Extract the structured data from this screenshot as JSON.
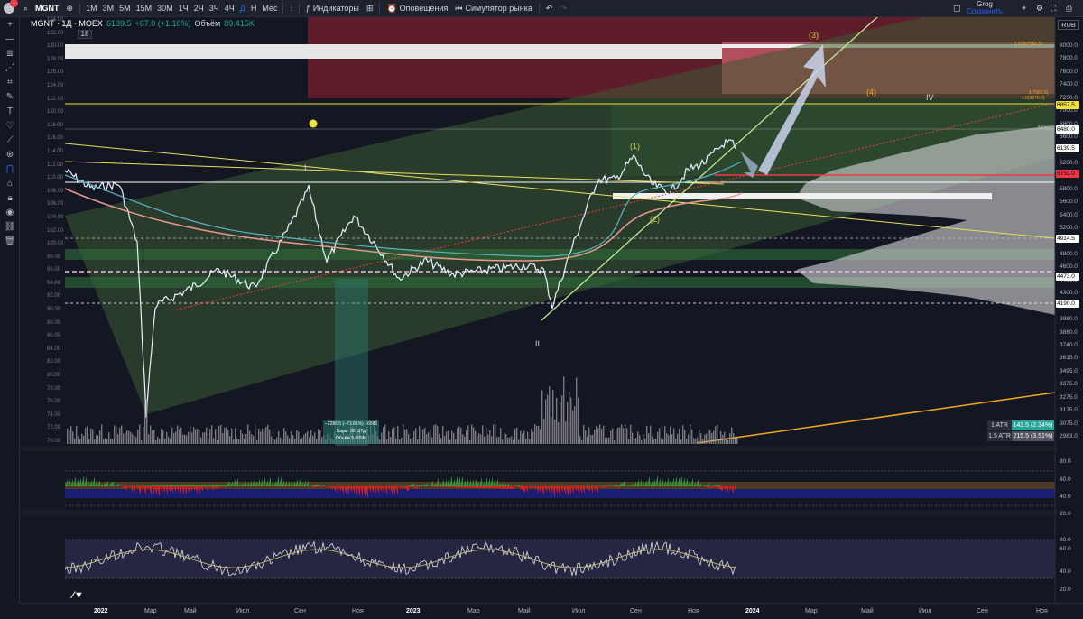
{
  "topbar": {
    "notif_count": "1",
    "symbol": "MGNT",
    "timeframes": [
      {
        "label": "1М",
        "active": false
      },
      {
        "label": "3М",
        "active": false
      },
      {
        "label": "5М",
        "active": false
      },
      {
        "label": "15М",
        "active": false
      },
      {
        "label": "30М",
        "active": false
      },
      {
        "label": "1Ч",
        "active": false
      },
      {
        "label": "2Ч",
        "active": false
      },
      {
        "label": "3Ч",
        "active": false
      },
      {
        "label": "4Ч",
        "active": false
      },
      {
        "label": "Д",
        "active": true
      },
      {
        "label": "Н",
        "active": false
      },
      {
        "label": "Мес",
        "active": false
      }
    ],
    "indicators_label": "Индикаторы",
    "alerts_label": "Оповещения",
    "replay_label": "Симулятор рынка",
    "user_name": "Grog",
    "save_label": "Сохранить"
  },
  "legend": {
    "title": "MGNT · 1Д · MOEX",
    "last": "6139.5",
    "change": "+67.0 (+1.10%)",
    "volume_label": "Объём",
    "volume": "89.415K",
    "series_count": "18"
  },
  "currency": "RUB",
  "right_axis": [
    "8000.0",
    "7800.0",
    "7600.0",
    "7400.0",
    "7200.0",
    "7000.0",
    "6800.0",
    "6600.0",
    "6400.0",
    "6200.0",
    "6000.0",
    "5800.0",
    "5600.0",
    "5400.0",
    "5200.0",
    "5000.0",
    "4800.0",
    "4600.0",
    "4400.0",
    "4300.0",
    "4100.0",
    "3980.0",
    "3860.0",
    "3740.0",
    "3615.0",
    "3495.0",
    "3375.0",
    "3275.0",
    "3175.0",
    "3075.0",
    "2983.0"
  ],
  "right_axis_top": [
    "8000.0",
    "7800.0",
    "7600.0",
    "7400.0",
    "7200.0",
    "7000.0",
    "6800.0",
    "6600.0",
    "6400.0",
    "6200.0",
    "6000.0",
    "5800.0",
    "5600.0",
    "5400.0",
    "5200.0",
    "5000.0",
    "4800.0",
    "4600.0",
    "4400.0",
    "4300.0",
    "4100.0",
    "3980.0",
    "3860.0",
    "3740.0",
    "3615.0",
    "3495.0",
    "3375.0",
    "3275.0",
    "3175.0",
    "3075.0",
    "2983.0"
  ],
  "price_labels": [
    {
      "text": "6857.5",
      "color": "#f0e040"
    },
    {
      "text": "6480.0",
      "color": "#ffffff"
    },
    {
      "text": "6139.5",
      "color": "#ffffff"
    },
    {
      "text": "5753.0",
      "color": "#f23645"
    },
    {
      "text": "4914.5",
      "color": "#ffffff"
    },
    {
      "text": "4473.0",
      "color": "#ffffff"
    },
    {
      "text": "4190.0",
      "color": "#ffffff"
    }
  ],
  "max_label": "Макс.",
  "fib_labels": [
    "1.618(7961.5)",
    "1(7062.5)",
    "1.0(6976.0)"
  ],
  "left_axis": [
    "134.00",
    "132.00",
    "130.00",
    "128.00",
    "126.00",
    "124.00",
    "122.00",
    "120.00",
    "118.00",
    "116.00",
    "114.00",
    "112.00",
    "110.00",
    "108.00",
    "106.00",
    "104.00",
    "102.00",
    "100.00",
    "98.00",
    "96.00",
    "94.00",
    "92.00",
    "90.00",
    "88.00",
    "86.00",
    "84.00",
    "82.00",
    "80.00",
    "78.00",
    "76.00",
    "74.00",
    "72.00",
    "70.00"
  ],
  "osc1_axis": [
    "80.0",
    "60.0",
    "40.0",
    "20.0"
  ],
  "osc2_axis": [
    "80.0",
    "60.0",
    "40.0",
    "20.0"
  ],
  "atr": [
    {
      "key": "1 ATR",
      "value": "143.5 (2.34%)",
      "color": "#26a69a"
    },
    {
      "key": "1.5 ATR",
      "value": "215.5 (3.51%)",
      "color": "#50535e"
    }
  ],
  "waves": [
    {
      "text": "(3)",
      "cls": "y"
    },
    {
      "text": "(4)",
      "cls": "o"
    },
    {
      "text": "IV",
      "cls": "w"
    },
    {
      "text": "(1)",
      "cls": "y"
    },
    {
      "text": "(2)",
      "cls": "y"
    },
    {
      "text": "I",
      "cls": "w"
    },
    {
      "text": "II",
      "cls": "w"
    }
  ],
  "measure": [
    "−2286.5 (−73.81%) −6586",
    "Бары: 36, 37д",
    "Объём 5.669М"
  ],
  "time_axis": [
    {
      "text": "2022",
      "year": true
    },
    {
      "text": "Мар",
      "year": false
    },
    {
      "text": "Май",
      "year": false
    },
    {
      "text": "Июл",
      "year": false
    },
    {
      "text": "Сен",
      "year": false
    },
    {
      "text": "Ноя",
      "year": false
    },
    {
      "text": "2023",
      "year": true
    },
    {
      "text": "Мар",
      "year": false
    },
    {
      "text": "Май",
      "year": false
    },
    {
      "text": "Июл",
      "year": false
    },
    {
      "text": "Сен",
      "year": false
    },
    {
      "text": "Ноя",
      "year": false
    },
    {
      "text": "2024",
      "year": true
    },
    {
      "text": "Мар",
      "year": false
    },
    {
      "text": "Май",
      "year": false
    },
    {
      "text": "Июл",
      "year": false
    },
    {
      "text": "Сен",
      "year": false
    },
    {
      "text": "Ноя",
      "year": false
    }
  ],
  "colors": {
    "bg": "#131722",
    "accent": "#2962ff",
    "up": "#26a69a",
    "down": "#f23645"
  }
}
